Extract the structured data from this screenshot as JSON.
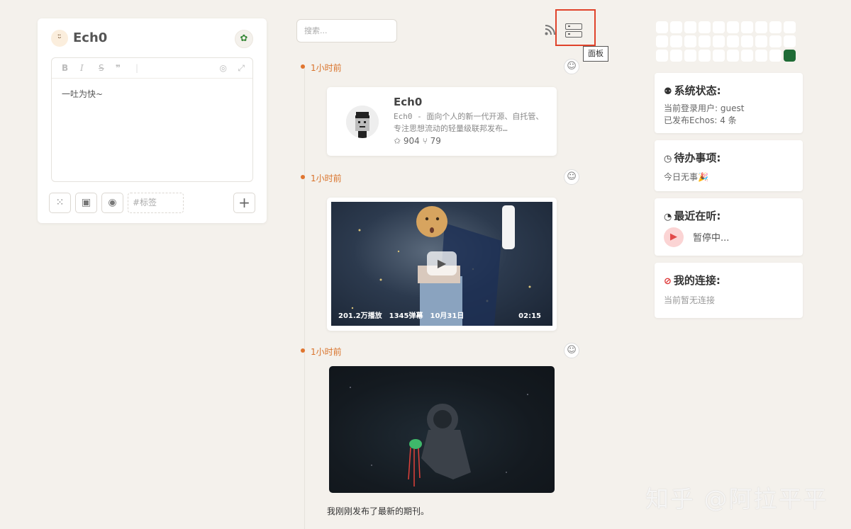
{
  "composer": {
    "username": "Ech0",
    "avatar_glyph": "ᵕ̈",
    "plant_glyph": "✿",
    "toolbar": {
      "bold": "B",
      "italic": "I",
      "strike": "S",
      "quote": "❞",
      "separator": "|",
      "preview": "◎",
      "expand": "⤢"
    },
    "editor_text": "一吐为快~",
    "grid_glyph": "⁙",
    "image_glyph": "▣",
    "eye_glyph": "◉",
    "tag_placeholder": "#标签",
    "add_glyph": "+"
  },
  "header": {
    "search_placeholder": "搜索...",
    "rss_glyph": "⊿",
    "panel_tooltip": "面板",
    "highlight_color": "#e0432b"
  },
  "timeline": {
    "accent_color": "#e0752f",
    "emoji_glyph": "☺",
    "posts": [
      {
        "time": "1小时前",
        "type": "repo",
        "repo_name": "Ech0",
        "repo_desc": "Ech0 - 面向个人的新一代开源、自托管、专注思想流动的轻量级联邦发布…",
        "stats": "✩ 904  ⑂ 79"
      },
      {
        "time": "1小时前",
        "type": "video",
        "play_glyph": "▶",
        "views": "201.2万播放",
        "danmaku": "1345弹幕",
        "date": "10月31日",
        "duration": "02:15"
      },
      {
        "time": "1小时前",
        "type": "image",
        "text": "我刚刚发布了最新的期刊。"
      }
    ]
  },
  "sidebar": {
    "heatmap_active_color": "#1f6b35",
    "system": {
      "icon": "⚉",
      "title": "系统状态:",
      "user_line": "当前登录用户: guest",
      "echos_line": "已发布Echos: 4 条"
    },
    "todo": {
      "icon": "◷",
      "title": "待办事项:",
      "line": "今日无事🎉"
    },
    "listening": {
      "icon": "◔",
      "title": "最近在听:",
      "play_glyph": "▶",
      "status": "暂停中..."
    },
    "connections": {
      "icon": "⊘",
      "title": "我的连接:",
      "line": "当前暂无连接"
    }
  },
  "watermark": "知乎 @阿拉平平"
}
